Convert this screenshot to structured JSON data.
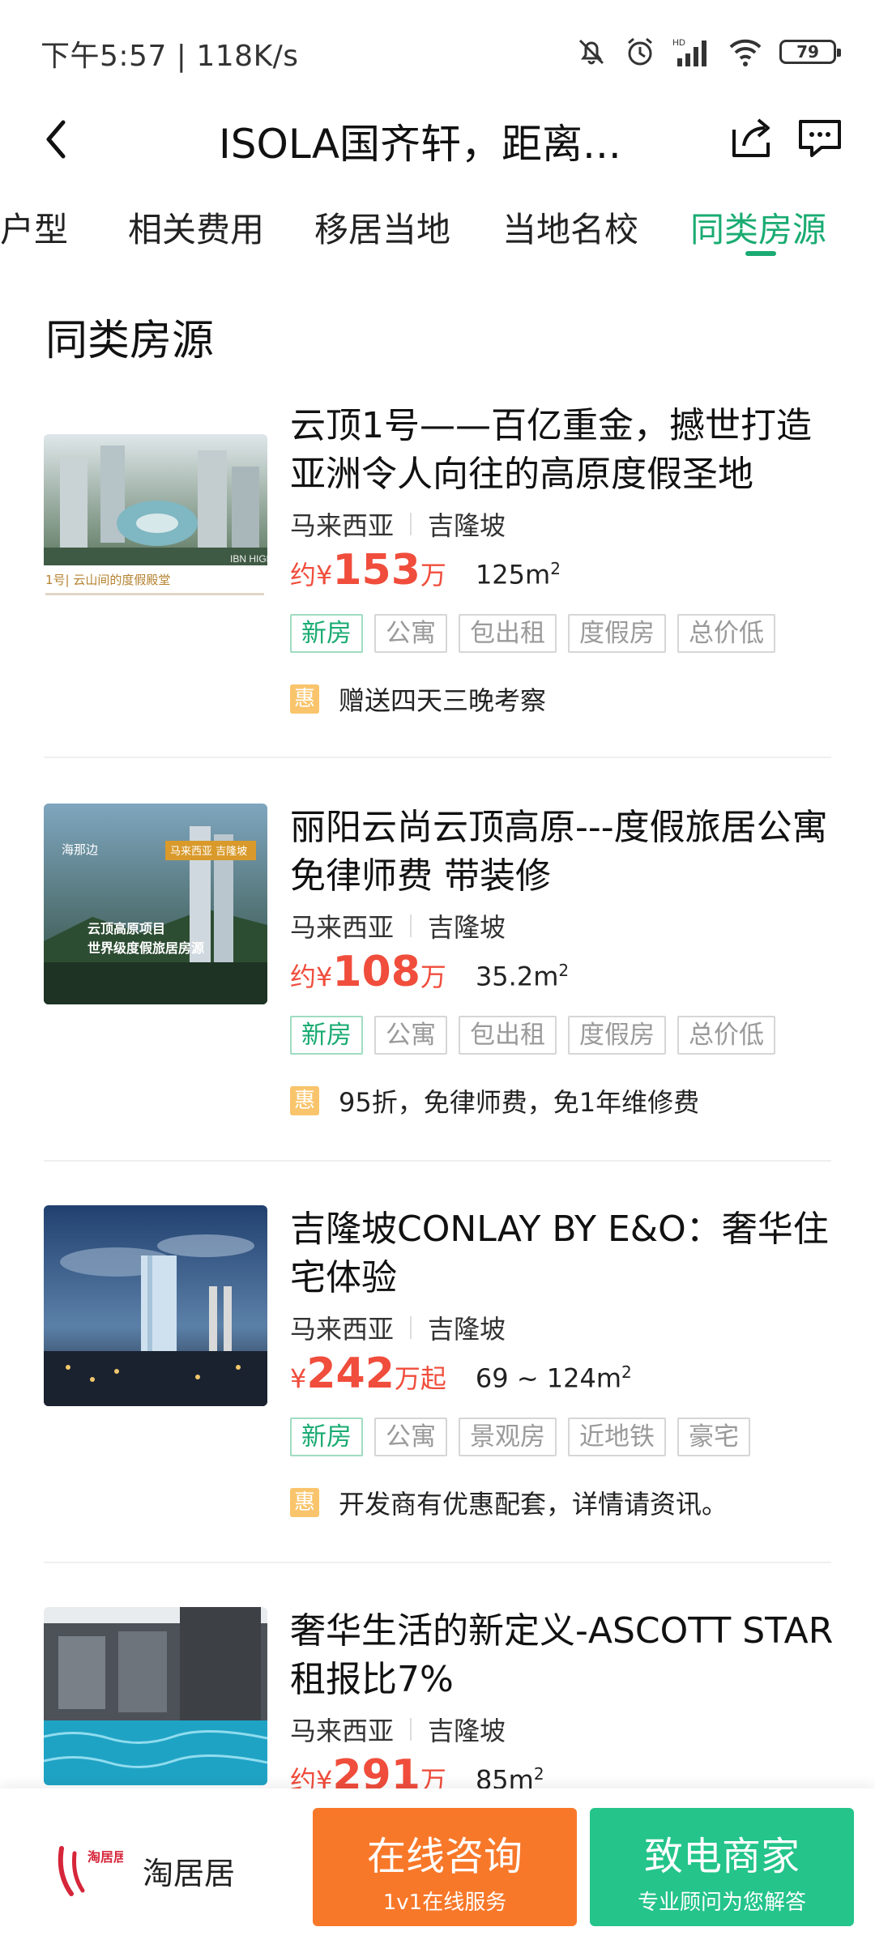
{
  "status": {
    "time": "下午5:57 | 118K/s",
    "battery": "79"
  },
  "header": {
    "title": "ISOLA国齐轩，距离..."
  },
  "tabs": [
    {
      "label": "推户型"
    },
    {
      "label": "相关费用"
    },
    {
      "label": "移居当地"
    },
    {
      "label": "当地名校"
    },
    {
      "label": "同类房源"
    }
  ],
  "section": {
    "title": "同类房源"
  },
  "listings": [
    {
      "title": "云顶1号——百亿重金，撼世打造亚洲令人向往的高原度假圣地",
      "country": "马来西亚",
      "city": "吉隆坡",
      "price_prefix": "约¥",
      "price": "153",
      "price_unit": "万",
      "area": "125m",
      "tags": [
        "新房",
        "公寓",
        "包出租",
        "度假房",
        "总价低"
      ],
      "promo_badge": "惠",
      "promo": "赠送四天三晚考察",
      "thumb_caption": "1号| 云山间的度假殿堂",
      "thumb_note": "IBN HIGHL"
    },
    {
      "title": "丽阳云尚云顶高原---度假旅居公寓 免律师费 带装修",
      "country": "马来西亚",
      "city": "吉隆坡",
      "price_prefix": "约¥",
      "price": "108",
      "price_unit": "万",
      "area": "35.2m",
      "tags": [
        "新房",
        "公寓",
        "包出租",
        "度假房",
        "总价低"
      ],
      "promo_badge": "惠",
      "promo": "95折，免律师费，免1年维修费",
      "thumb_logo": "海那边",
      "thumb_badge": "马来西亚 吉隆坡",
      "thumb_line1": "云顶高原项目",
      "thumb_line2": "世界级度假旅居房源"
    },
    {
      "title": "吉隆坡CONLAY BY E&O：奢华住宅体验",
      "country": "马来西亚",
      "city": "吉隆坡",
      "price_prefix": "¥",
      "price": "242",
      "price_unit": "万起",
      "area": "69 ~ 124m",
      "tags": [
        "新房",
        "公寓",
        "景观房",
        "近地铁",
        "豪宅"
      ],
      "promo_badge": "惠",
      "promo": "开发商有优惠配套，详情请资讯。"
    },
    {
      "title": "奢华生活的新定义-ASCOTT STAR 租报比7%",
      "country": "马来西亚",
      "city": "吉隆坡",
      "price_prefix": "约¥",
      "price": "291",
      "price_unit": "万",
      "area": "85m"
    }
  ],
  "area_sup": "2",
  "bottom": {
    "brand": "淘居居",
    "logo_text": "淘居居",
    "consult_main": "在线咨询",
    "consult_sub": "1v1在线服务",
    "call_main": "致电商家",
    "call_sub": "专业顾问为您解答"
  },
  "colors": {
    "accent_green": "#1aab72",
    "price_red": "#f04d3c",
    "cta_orange": "#f8782a",
    "cta_green": "#24c48a",
    "promo_yellow": "#f9c46b"
  }
}
